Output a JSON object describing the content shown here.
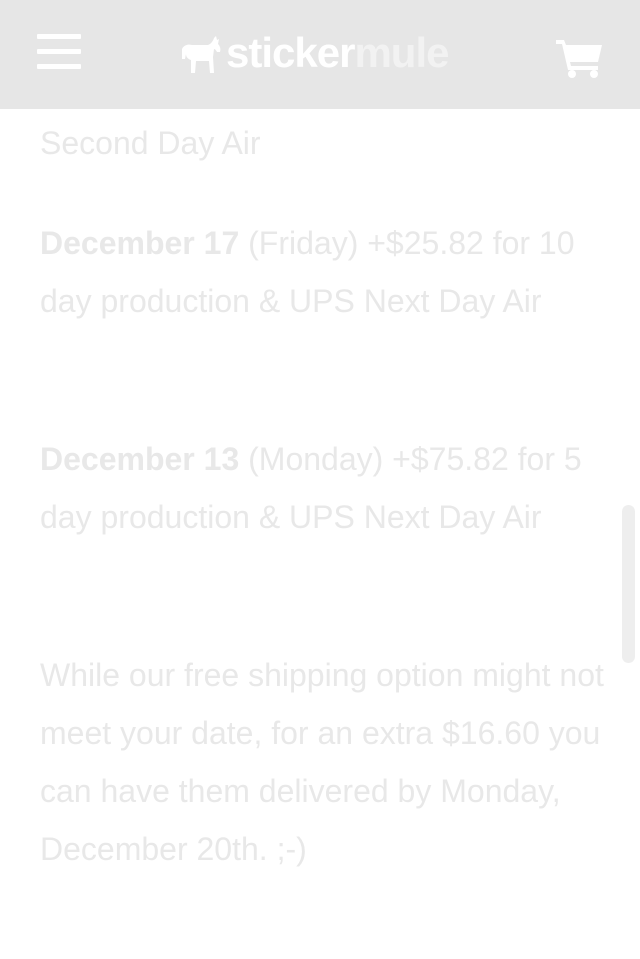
{
  "header": {
    "brand_part1": "sticker",
    "brand_part2": "mule"
  },
  "content": {
    "p0_text": "Second Day Air",
    "p1_date": "December 17",
    "p1_rest": " (Friday) +$25.82 for 10 day production & UPS Next Day Air",
    "p2_date": "December 13",
    "p2_rest": " (Monday) +$75.82 for 5 day production & UPS Next Day Air",
    "p3_text": "While our free shipping option might not meet your date, for an extra $16.60 you can have them delivered by Monday, December 20th. ;-)"
  },
  "icons": {
    "menu": "hamburger-menu-icon",
    "cart": "shopping-cart-icon",
    "logo": "mule-logo-icon"
  },
  "colors": {
    "header_bg": "#e6e6e6",
    "text": "#e8e8e8",
    "icon": "#ffffff"
  }
}
